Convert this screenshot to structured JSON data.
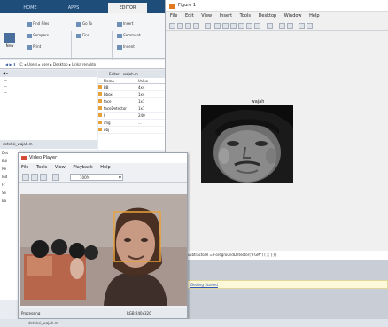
{
  "matlab": {
    "tabs": [
      {
        "label": "HOME",
        "active": false
      },
      {
        "label": "APPS",
        "active": false
      },
      {
        "label": "EDITOR",
        "active": true
      }
    ],
    "ribbon": {
      "new_label": "New",
      "buttons": [
        "Find Files",
        "Compare",
        "Print",
        "Go To",
        "Find",
        "Insert",
        "Comment",
        "Indent",
        "Breakpoints"
      ],
      "groups": [
        "FILE",
        "NAVIGATE",
        "EDIT"
      ]
    },
    "address": {
      "path": "C: ▸ Users ▸ user ▸ Desktop ▸ Linka renaldo"
    },
    "workspace": {
      "title": "Editor - wajah.m",
      "columns": [
        "Name",
        "Value"
      ],
      "rows": [
        {
          "name": "BB",
          "value": "4x4"
        },
        {
          "name": "bbox",
          "value": "1x4"
        },
        {
          "name": "face",
          "value": "1x1"
        },
        {
          "name": "faceDetector",
          "value": "1x1"
        },
        {
          "name": "I",
          "value": "240"
        },
        {
          "name": "img",
          "value": "..."
        },
        {
          "name": "obj",
          "value": ""
        }
      ]
    },
    "details_label": "deteksi_wajah.m",
    "left_items": [
      "Det",
      "Edi",
      "Re",
      "Ind",
      "Fr",
      "Se",
      "Ba"
    ]
  },
  "video_player": {
    "title": "Video Player",
    "menu": [
      "File",
      "Tools",
      "View",
      "Playback",
      "Help"
    ],
    "zoom": "100%",
    "status_left": "Processing",
    "status_right": "RGB:240x320"
  },
  "figure": {
    "title": "Figure 1",
    "menu": [
      "File",
      "Edit",
      "View",
      "Insert",
      "Tools",
      "Desktop",
      "Window",
      "Help"
    ],
    "axes_title": "wajah"
  },
  "command": {
    "line": "obj.SubtractorR = ForegroundDetector(\"FGM\") ( ); }}}",
    "hint_prefix": "",
    "hint_link": "Getting Started"
  },
  "bottom": {
    "text": "deteksi_wajah.m"
  },
  "colors": {
    "matlab_tab_bar": "#1f4d7a",
    "hint_bar": "#fdf8d8",
    "figure_icon": "#e07a1f"
  }
}
